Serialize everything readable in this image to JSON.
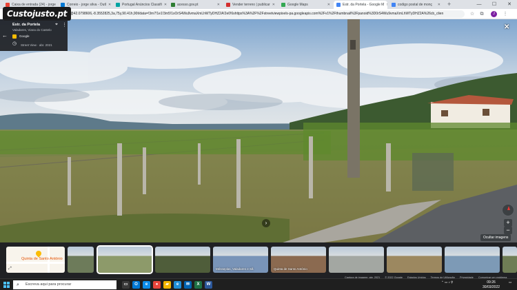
{
  "browser": {
    "tabs": [
      {
        "label": "Caixa de entrada (24) - jorge",
        "color": "#ea4335",
        "active": false
      },
      {
        "label": "Correio - jorge silva - Outl",
        "color": "#0078d4",
        "active": false
      },
      {
        "label": "Portugal Anúncios Classifi",
        "color": "#00a3a3",
        "active": false
      },
      {
        "label": "acesso.gov.pt",
        "color": "#2e7d32",
        "active": false
      },
      {
        "label": "Vender terreno | publicar",
        "color": "#d32f2f",
        "active": false
      },
      {
        "label": "Google Maps",
        "color": "#34a853",
        "active": false
      },
      {
        "label": "Estr. da Portela - Google M",
        "color": "#4285f4",
        "active": true
      },
      {
        "label": "codigo postal de monç",
        "color": "#4285f4",
        "active": false
      }
    ],
    "new_tab_label": "+",
    "minimize": "—",
    "maximize": "☐",
    "close": "✕",
    "url": "maps/@42.0798606,-8.3552825,3a,75y,90.41h,90t/data=!3m7!1e1!3m5!1sOrS4Wu9vmaXmLhWTyDHZ2A!2e0!6shttps%3A%2F%2Fstreetviewpixels-pa.googleapis.com%2Fv1%2Fthumbnail%3Fpanoid%3D0rS4Wu9vmaXmLhWTyDHZ2A%26cb_clien",
    "profile_initial": "J"
  },
  "logo": {
    "text": "Custojusto.pt"
  },
  "infocard": {
    "place": "Estr. da Portela",
    "subtitle": "Valadares, Viana do Castelo",
    "provider": "Google",
    "street_view": "Street View · abr. 2021",
    "back_icon": "arrow-left-icon",
    "pin_icon": "location-pin-icon",
    "more_icon": "more-vert-icon"
  },
  "controls": {
    "close": "✕",
    "zoom_in": "+",
    "zoom_out": "−",
    "hide_images": "Ocultar imagens",
    "next_arrow": "›"
  },
  "strip": {
    "map_label": "Quinta de Santo António",
    "thumbs": [
      {
        "caption": "",
        "bg": "#6d7b5a"
      },
      {
        "caption": "",
        "bg": "#8d9a6a"
      },
      {
        "caption": "",
        "bg": "#4f5d3a"
      },
      {
        "caption": "Mésseplas, Valadares e Sã",
        "bg": "#7994b8"
      },
      {
        "caption": "Quinta de Santo António",
        "bg": "#8b6a50"
      },
      {
        "caption": "",
        "bg": "#a3a7a2"
      },
      {
        "caption": "",
        "bg": "#9c8860"
      },
      {
        "caption": "",
        "bg": "#7d9ab6"
      },
      {
        "caption": "",
        "bg": "#6f7d55"
      }
    ]
  },
  "footer": {
    "capture": "Captura de imagem: abr. 2021",
    "copyright": "© 2022 Google",
    "country": "Estados Unidos",
    "terms": "Termos de Utilização",
    "privacy": "Privacidade",
    "report": "Comunicar um problema"
  },
  "taskbar": {
    "search_placeholder": "Escreva aqui para procurar",
    "clock_time": "09:26",
    "clock_date": "30/03/2022",
    "apps": [
      {
        "icon": "task-view-icon",
        "glyph": "▭",
        "color": "#3a3a3a"
      },
      {
        "icon": "outlook-icon",
        "glyph": "O",
        "color": "#0078d4"
      },
      {
        "icon": "edge-icon",
        "glyph": "e",
        "color": "#0c8ce9"
      },
      {
        "icon": "chrome-icon",
        "glyph": "●",
        "color": "#e8453c"
      },
      {
        "icon": "file-explorer-icon",
        "glyph": "▰",
        "color": "#f4b400"
      },
      {
        "icon": "edge-icon",
        "glyph": "e",
        "color": "#1f8ed8"
      },
      {
        "icon": "mail-icon",
        "glyph": "✉",
        "color": "#0063b1"
      },
      {
        "icon": "excel-icon",
        "glyph": "X",
        "color": "#1e7145"
      },
      {
        "icon": "word-icon",
        "glyph": "W",
        "color": "#2b579a"
      }
    ]
  }
}
